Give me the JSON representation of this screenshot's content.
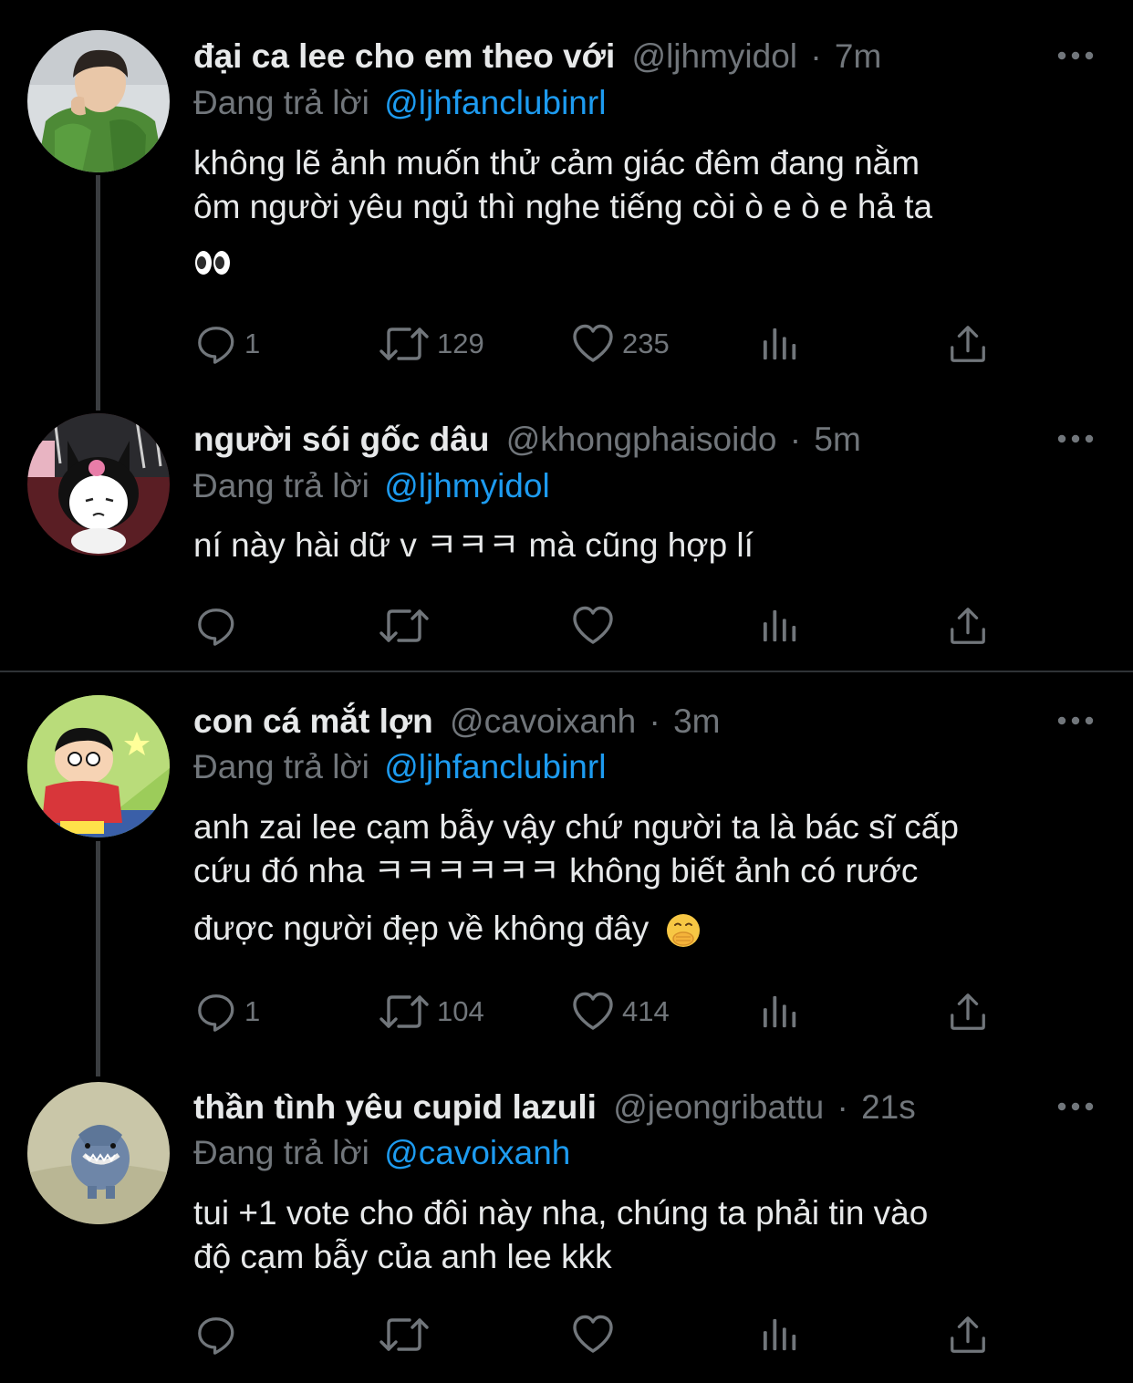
{
  "tweets": [
    {
      "name": "đại ca lee cho em theo với",
      "handle": "@ljhmyidol",
      "time": "7m",
      "reply_prefix": "Đang trả lời",
      "reply_to": "@ljhfanclubinrl",
      "lines": [
        "không lẽ ảnh muốn thử cảm giác đêm đang nằm",
        "ôm người yêu ngủ thì nghe tiếng còi ò e ò e hả ta"
      ],
      "emoji": "eyes-emoji",
      "replies": "1",
      "retweets": "129",
      "likes": "235"
    },
    {
      "name": "người sói gốc dâu",
      "handle": "@khongphaisoido",
      "time": "5m",
      "reply_prefix": "Đang trả lời",
      "reply_to": "@ljhmyidol",
      "lines": [
        "ní này hài dữ v ㅋㅋㅋ mà cũng hợp lí"
      ],
      "replies": "",
      "retweets": "",
      "likes": ""
    },
    {
      "name": "con cá mắt lợn",
      "handle": "@cavoixanh",
      "time": "3m",
      "reply_prefix": "Đang trả lời",
      "reply_to": "@ljhfanclubinrl",
      "lines": [
        "anh zai lee cạm bẫy vậy chứ người ta là bác sĩ cấp",
        "cứu đó nha ㅋㅋㅋㅋㅋㅋ không biết ảnh có rước",
        "được người đẹp về không đây"
      ],
      "emoji": "face-with-hand-over-mouth-emoji",
      "replies": "1",
      "retweets": "104",
      "likes": "414"
    },
    {
      "name": "thần tình yêu cupid lazuli",
      "handle": "@jeongribattu",
      "time": "21s",
      "reply_prefix": "Đang trả lời",
      "reply_to": "@cavoixanh",
      "lines": [
        "tui +1 vote cho đôi này nha, chúng ta phải tin vào",
        "độ cạm bẫy của anh lee kkk"
      ],
      "replies": "",
      "retweets": "",
      "likes": ""
    }
  ],
  "separator": "·",
  "colors": {
    "background": "#000000",
    "text": "#e7e9ea",
    "muted": "#71767b",
    "link": "#1d9bf0",
    "thread_line": "#3a3d40",
    "divider": "#2f3336"
  },
  "icons": [
    "reply-icon",
    "retweet-icon",
    "like-icon",
    "views-icon",
    "share-icon",
    "more-icon"
  ]
}
